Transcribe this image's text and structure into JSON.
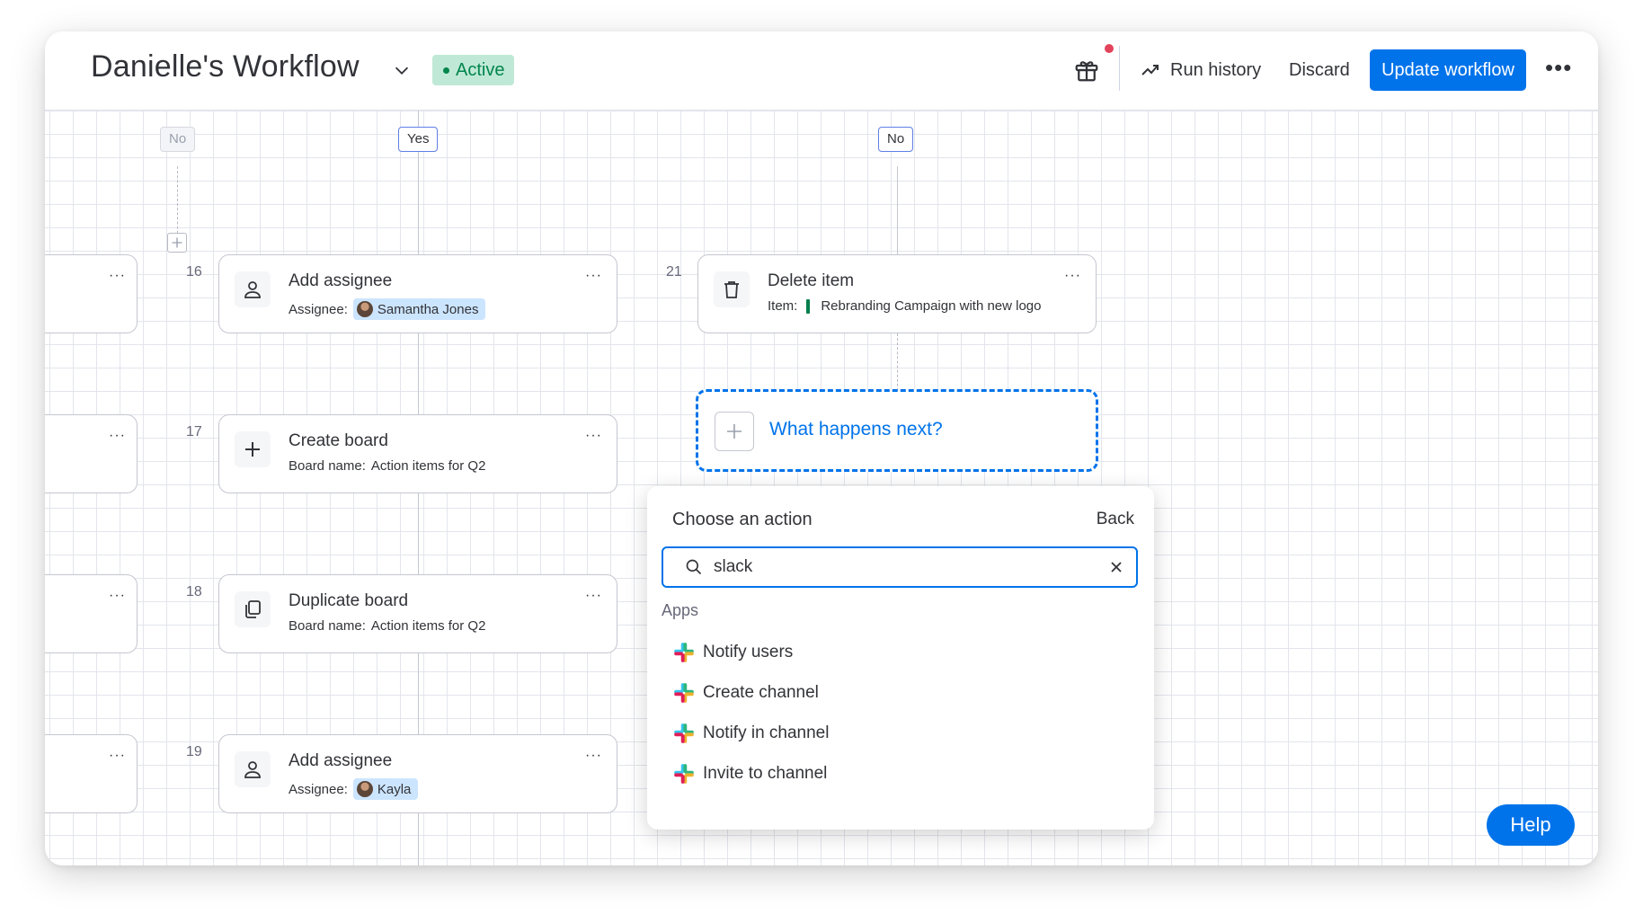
{
  "header": {
    "title": "Danielle's Workflow",
    "status": "Active",
    "run_history": "Run history",
    "discard": "Discard",
    "update": "Update workflow",
    "more": "•••"
  },
  "branches": {
    "left_no": "No",
    "yes": "Yes",
    "right_no": "No"
  },
  "steps": [
    {
      "num": "16",
      "title": "Add assignee",
      "sub_label": "Assignee:",
      "pill": "Samantha Jones"
    },
    {
      "num": "17",
      "title": "Create board",
      "sub_label": "Board name:",
      "sub_value": "Action items for Q2"
    },
    {
      "num": "18",
      "title": "Duplicate board",
      "sub_label": "Board name:",
      "sub_value": "Action items for Q2"
    },
    {
      "num": "19",
      "title": "Add assignee",
      "sub_label": "Assignee:",
      "pill": "Kayla"
    },
    {
      "num": "21",
      "title": "Delete item",
      "sub_label": "Item:",
      "sub_value": "Rebranding Campaign with new logo"
    }
  ],
  "card_more": "···",
  "next": {
    "label": "What happens next?"
  },
  "popover": {
    "title": "Choose an action",
    "back": "Back",
    "search_value": "slack",
    "section": "Apps",
    "actions": [
      "Notify users",
      "Create channel",
      "Notify in channel",
      "Invite to channel"
    ]
  },
  "help": "Help",
  "colors": {
    "accent": "#0073ea",
    "active_bg": "#bfe9d6",
    "active_text": "#00854d",
    "pill_bg": "#cce5ff",
    "notification": "#e2445c"
  },
  "icons": {
    "title_chevron": "chevron-down-icon",
    "gift": "gift-icon",
    "run_history": "trend-icon",
    "assignee": "person-icon",
    "create_board": "plus-icon",
    "duplicate_board": "copy-icon",
    "delete_item": "trash-icon",
    "search": "search-icon",
    "clear": "close-icon",
    "slack": "slack-icon"
  }
}
